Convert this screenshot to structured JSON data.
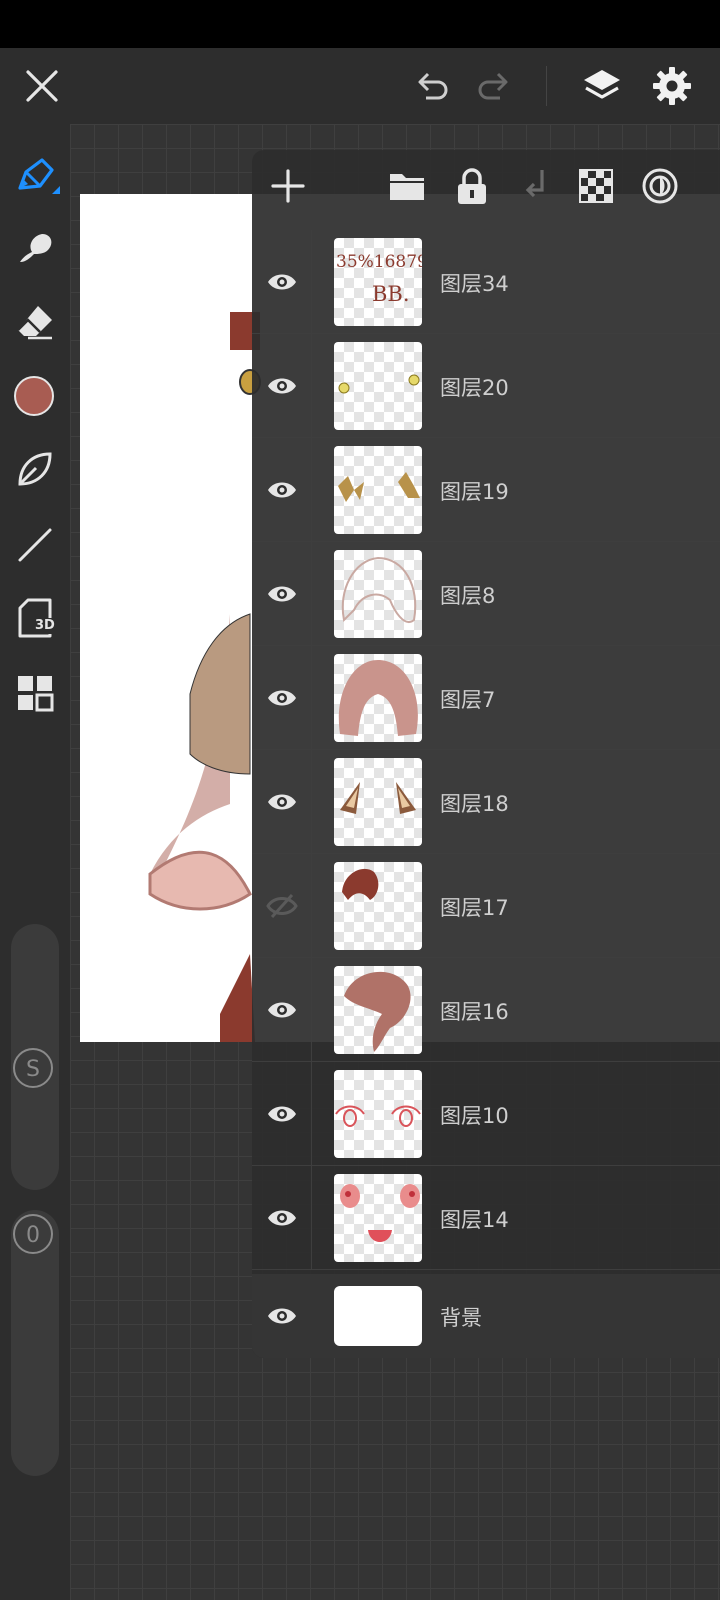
{
  "topbar": {
    "close_icon": "close-icon",
    "undo_icon": "undo-icon",
    "redo_icon": "redo-icon",
    "layers_icon": "layers-icon",
    "settings_icon": "gear-icon"
  },
  "tools": [
    {
      "name": "brush",
      "icon": "brush-icon",
      "active": true
    },
    {
      "name": "smudge",
      "icon": "smudge-icon"
    },
    {
      "name": "eraser",
      "icon": "eraser-icon"
    },
    {
      "name": "color",
      "icon": "color-swatch",
      "color": "#a85c52"
    },
    {
      "name": "selection",
      "icon": "lasso-icon"
    },
    {
      "name": "line",
      "icon": "line-icon"
    },
    {
      "name": "3d",
      "icon": "3d-icon",
      "label": "3D"
    },
    {
      "name": "more",
      "icon": "grid-icon"
    }
  ],
  "sliders": {
    "size_label": "S",
    "opacity_label": "0"
  },
  "layer_panel": {
    "toolbar": [
      "add-icon",
      "folder-icon",
      "lock-icon",
      "merge-down-icon",
      "transparency-icon",
      "blend-icon"
    ],
    "layers": [
      {
        "name": "图层34",
        "visible": true
      },
      {
        "name": "图层20",
        "visible": true
      },
      {
        "name": "图层19",
        "visible": true
      },
      {
        "name": "图层8",
        "visible": true
      },
      {
        "name": "图层7",
        "visible": true
      },
      {
        "name": "图层18",
        "visible": true
      },
      {
        "name": "图层17",
        "visible": false
      },
      {
        "name": "图层16",
        "visible": true
      },
      {
        "name": "图层10",
        "visible": true
      },
      {
        "name": "图层14",
        "visible": true
      }
    ],
    "background": {
      "name": "背景",
      "visible": true
    }
  },
  "thumbnail_34_text": [
    "35%16879",
    "BB."
  ],
  "colors": {
    "accent": "#1e90ff",
    "primary_color": "#a85c52"
  }
}
